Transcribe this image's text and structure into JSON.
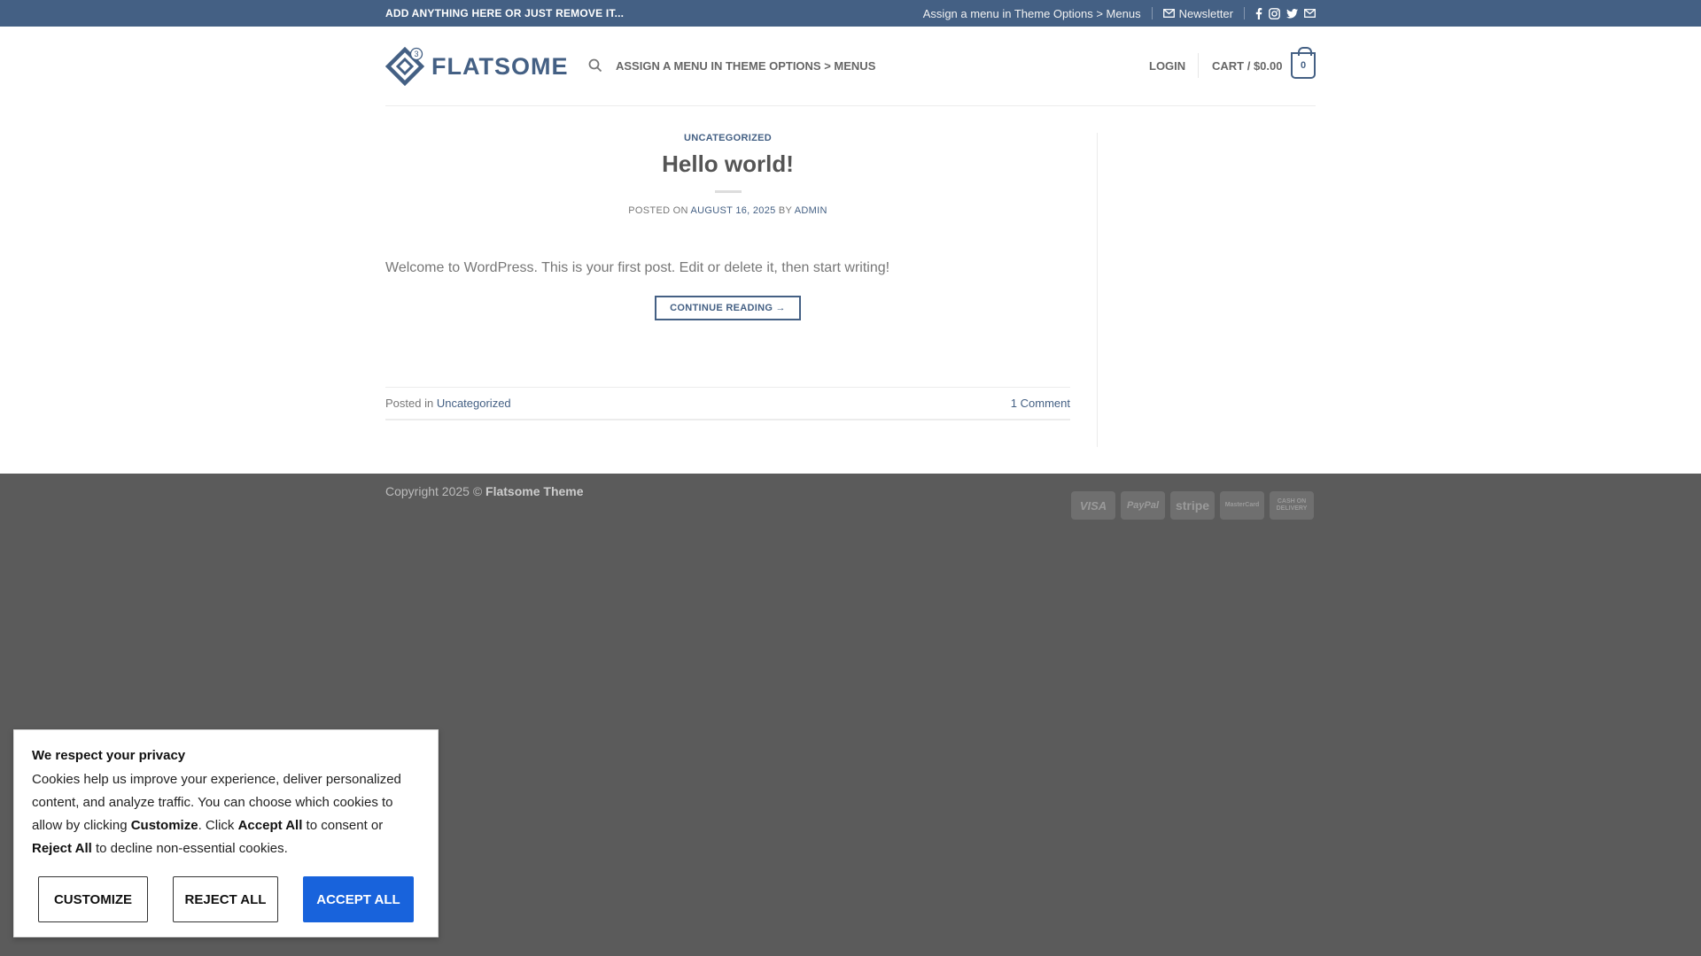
{
  "topbar": {
    "promo": "ADD ANYTHING HERE OR JUST REMOVE IT...",
    "menu_note": "Assign a menu in Theme Options > Menus",
    "newsletter": "Newsletter",
    "social_icons": [
      "facebook-icon",
      "instagram-icon",
      "twitter-icon",
      "envelope-icon"
    ],
    "bg_color": "#446084"
  },
  "header": {
    "logo_text": "FLATSOME",
    "logo_badge": "3",
    "menu_note": "ASSIGN A MENU IN THEME OPTIONS > MENUS",
    "login": "LOGIN",
    "cart_label": "CART / $0.00",
    "cart_count": "0"
  },
  "post": {
    "category": "UNCATEGORIZED",
    "title": "Hello world!",
    "posted_on": "POSTED ON",
    "date": "AUGUST 16, 2025",
    "by": "BY",
    "author": "ADMIN",
    "excerpt": "Welcome to WordPress. This is your first post. Edit or delete it, then start writing!",
    "continue": "CONTINUE READING →",
    "posted_in": "Posted in",
    "posted_in_cat": "Uncategorized",
    "comments": "1 Comment"
  },
  "footer": {
    "copyright_prefix": "Copyright 2025 ©",
    "copyright_name": "Flatsome Theme",
    "payments": [
      "VISA",
      "PayPal",
      "stripe",
      "MasterCard",
      "CASH ON DELIVERY"
    ]
  },
  "cookie": {
    "title": "We respect your privacy",
    "text_1": "Cookies help us improve your experience, deliver personalized content, and analyze traffic. You can choose which cookies to allow by clicking",
    "bold_customize": "Customize",
    "text_2": ". Click",
    "bold_accept": "Accept All",
    "text_3": "to consent or",
    "bold_reject": "Reject All",
    "text_4": "to decline non-essential cookies.",
    "btn_customize": "CUSTOMIZE",
    "btn_reject": "REJECT ALL",
    "btn_accept": "ACCEPT ALL",
    "accent": "#1863dc"
  }
}
